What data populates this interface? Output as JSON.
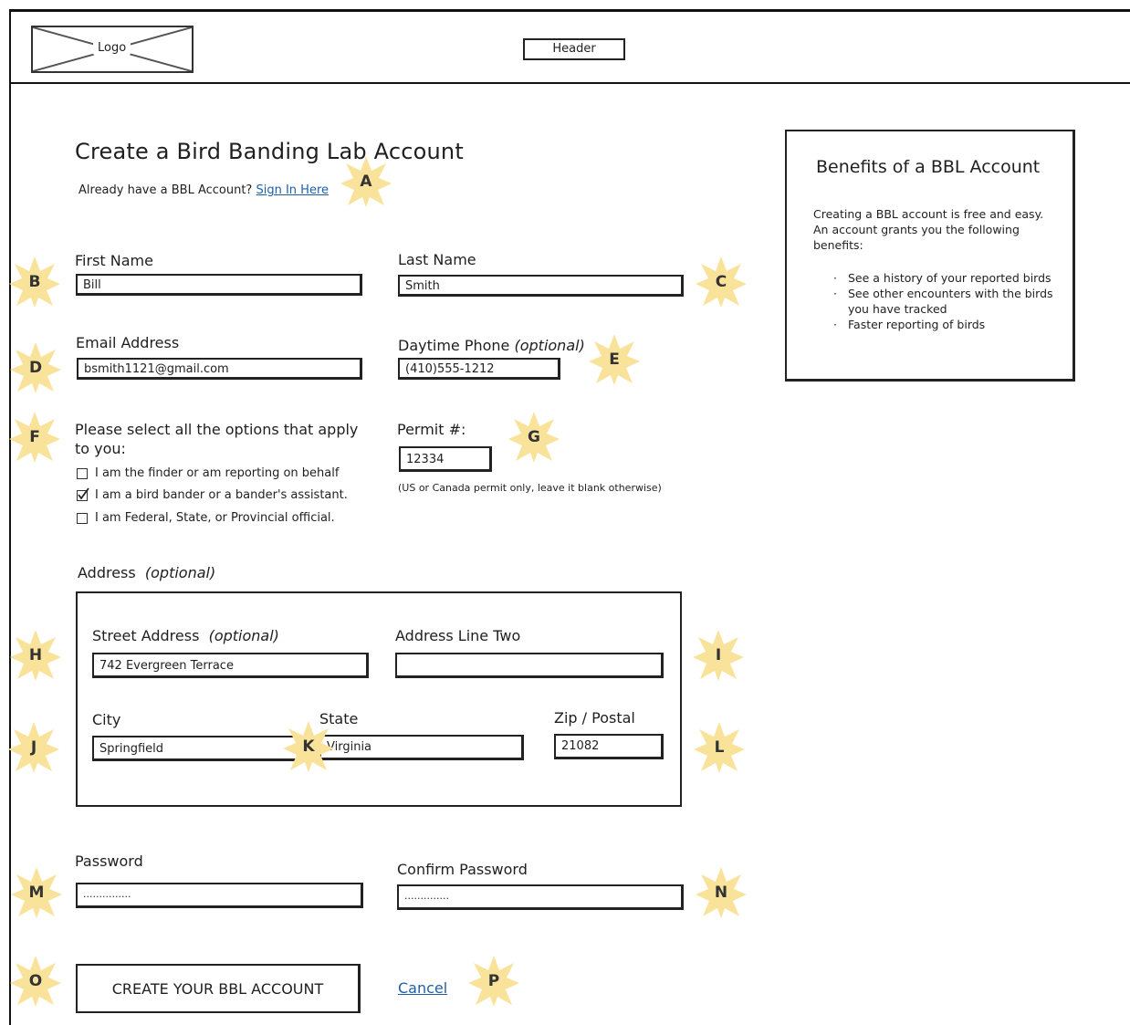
{
  "header": {
    "logo_label": "Logo",
    "header_label": "Header"
  },
  "page": {
    "title": "Create a Bird Banding Lab Account",
    "already_text": "Already have a BBL Account?",
    "sign_in_link": "Sign In Here"
  },
  "form": {
    "first_name": {
      "label": "First Name",
      "value": "Bill"
    },
    "last_name": {
      "label": "Last Name",
      "value": "Smith"
    },
    "email": {
      "label": "Email Address",
      "value": "bsmith1121@gmail.com"
    },
    "phone": {
      "label": "Daytime Phone",
      "optional": "(optional)",
      "value": "(410)555-1212"
    },
    "options": {
      "label": "Please select all the options that apply to you:",
      "items": [
        {
          "label": "I am the finder or am reporting on behalf",
          "checked": false
        },
        {
          "label": "I am a bird bander or a bander's assistant.",
          "checked": true
        },
        {
          "label": "I am Federal, State, or Provincial official.",
          "checked": false
        }
      ]
    },
    "permit": {
      "label": "Permit #:",
      "value": "12334",
      "note": "(US or Canada permit only, leave it blank otherwise)"
    },
    "address": {
      "label": "Address",
      "optional": "(optional)",
      "street": {
        "label": "Street Address",
        "optional": "(optional)",
        "value": "742 Evergreen Terrace"
      },
      "line_two": {
        "label": "Address Line Two",
        "value": ""
      },
      "city": {
        "label": "City",
        "value": "Springfield"
      },
      "state": {
        "label": "State",
        "value": "Virginia"
      },
      "zip": {
        "label": "Zip / Postal",
        "value": "21082"
      }
    },
    "password": {
      "label": "Password",
      "value": "..............."
    },
    "confirm_password": {
      "label": "Confirm Password",
      "value": ".............."
    },
    "create_button": "CREATE YOUR BBL ACCOUNT",
    "cancel_link": "Cancel"
  },
  "benefits": {
    "title": "Benefits of a BBL Account",
    "intro": "Creating a BBL account is free and easy. An account grants you the following benefits:",
    "items": [
      "See a history of your reported birds",
      "See other encounters with the birds you have tracked",
      "Faster reporting of birds"
    ]
  },
  "annotations": [
    "A",
    "B",
    "C",
    "D",
    "E",
    "F",
    "G",
    "H",
    "I",
    "J",
    "K",
    "L",
    "M",
    "N",
    "O",
    "P"
  ],
  "colors": {
    "annotation_star": "#f9e39a",
    "link": "#1f5fa8",
    "border": "#222222"
  }
}
